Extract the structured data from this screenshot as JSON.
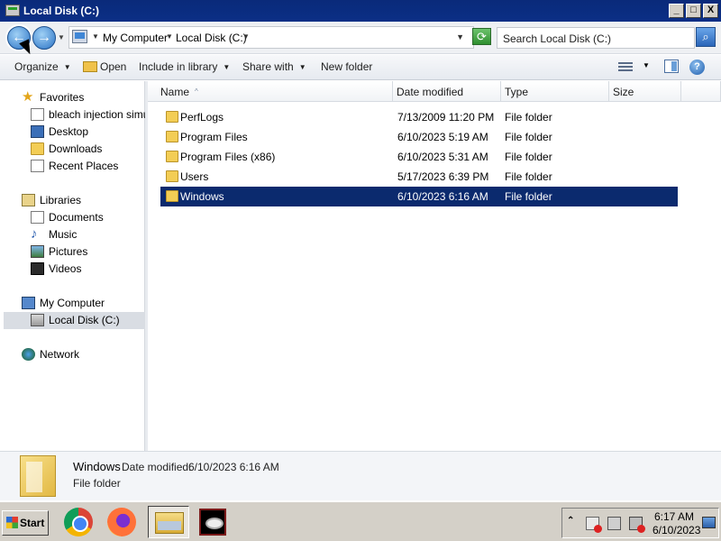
{
  "window": {
    "title": "Local Disk (C:)",
    "controls": {
      "minimize": "_",
      "maximize": "□",
      "close": "X"
    }
  },
  "address": {
    "back_icon": "back-arrow-icon",
    "forward_icon": "forward-arrow-icon",
    "crumbs": [
      "My Computer",
      "Local Disk (C:)"
    ],
    "search_placeholder": "Search Local Disk (C:)"
  },
  "toolbar": {
    "organize": "Organize",
    "open": "Open",
    "include_in_library": "Include in library",
    "share_with": "Share with",
    "new_folder": "New folder"
  },
  "nav": {
    "favorites": {
      "label": "Favorites",
      "items": [
        "bleach injection simula",
        "Desktop",
        "Downloads",
        "Recent Places"
      ]
    },
    "libraries": {
      "label": "Libraries",
      "items": [
        "Documents",
        "Music",
        "Pictures",
        "Videos"
      ]
    },
    "computer": {
      "label": "My Computer",
      "items": [
        "Local Disk (C:)"
      ]
    },
    "network": {
      "label": "Network"
    }
  },
  "files": {
    "columns": [
      "Name",
      "Date modified",
      "Type",
      "Size"
    ],
    "rows": [
      {
        "name": "PerfLogs",
        "date": "7/13/2009 11:20 PM",
        "type": "File folder"
      },
      {
        "name": "Program Files",
        "date": "6/10/2023 5:19 AM",
        "type": "File folder"
      },
      {
        "name": "Program Files (x86)",
        "date": "6/10/2023 5:31 AM",
        "type": "File folder"
      },
      {
        "name": "Users",
        "date": "5/17/2023 6:39 PM",
        "type": "File folder"
      },
      {
        "name": "Windows",
        "date": "6/10/2023 6:16 AM",
        "type": "File folder"
      }
    ],
    "selected_index": 4
  },
  "details": {
    "name": "Windows",
    "date_label": "Date modified:",
    "date_value": "6/10/2023 6:16 AM",
    "type": "File folder"
  },
  "taskbar": {
    "start": "Start",
    "apps": [
      "chrome-icon",
      "firefox-icon",
      "explorer-icon",
      "eye-app-icon"
    ],
    "clock_time": "6:17 AM",
    "clock_date": "6/10/2023"
  },
  "colors": {
    "title_bar": "#0b2f86",
    "selection": "#0b2a6e",
    "taskbar": "#d4d0c8"
  }
}
